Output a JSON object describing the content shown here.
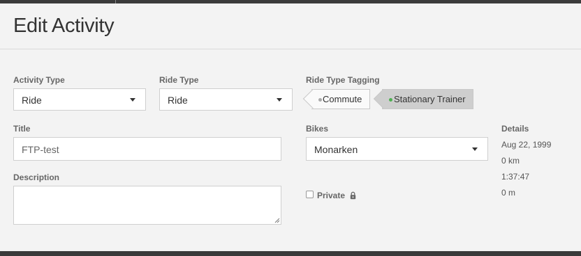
{
  "modal": {
    "title": "Edit Activity"
  },
  "activity_type": {
    "label": "Activity Type",
    "value": "Ride"
  },
  "ride_type": {
    "label": "Ride Type",
    "value": "Ride"
  },
  "ride_type_tagging": {
    "label": "Ride Type Tagging",
    "tags": [
      {
        "label": "Commute",
        "active": false
      },
      {
        "label": "Stationary Trainer",
        "active": true
      }
    ]
  },
  "title_field": {
    "label": "Title",
    "value": "FTP-test"
  },
  "bikes": {
    "label": "Bikes",
    "value": "Monarken"
  },
  "description": {
    "label": "Description",
    "value": ""
  },
  "private": {
    "label": "Private",
    "checked": false,
    "icon": "lock-icon"
  },
  "details": {
    "label": "Details",
    "date": "Aug 22, 1999",
    "distance": "0 km",
    "time": "1:37:47",
    "elevation": "0 m"
  },
  "colors": {
    "active_dot": "#4caf50",
    "inactive_dot": "#aaaaaa"
  }
}
